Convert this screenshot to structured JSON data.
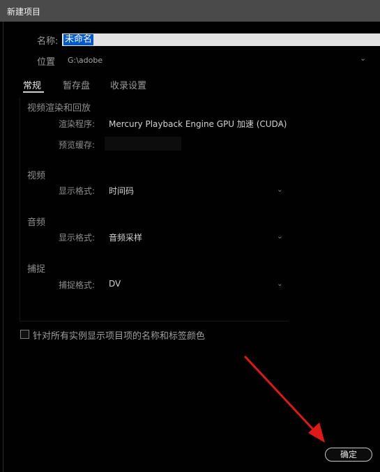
{
  "window": {
    "title": "新建项目"
  },
  "name": {
    "label": "名称:",
    "value": "未命名"
  },
  "location": {
    "label": "位置",
    "value": "G:\\adobe"
  },
  "tabs": [
    {
      "label": "常规",
      "active": true
    },
    {
      "label": "暂存盘",
      "active": false
    },
    {
      "label": "收录设置",
      "active": false
    }
  ],
  "video_render": {
    "section": "视频渲染和回放",
    "renderer_label": "渲染程序:",
    "renderer_value": "Mercury Playback Engine GPU 加速 (CUDA)",
    "cache_label": "预览缓存:"
  },
  "video": {
    "section": "视频",
    "format_label": "显示格式:",
    "format_value": "时间码"
  },
  "audio": {
    "section": "音频",
    "format_label": "显示格式:",
    "format_value": "音频采样"
  },
  "capture": {
    "section": "捕捉",
    "format_label": "捕捉格式:",
    "format_value": "DV"
  },
  "options": {
    "checkbox_label": "针对所有实例显示项目项的名称和标签颜色",
    "checked": false
  },
  "buttons": {
    "ok_label": "确定"
  },
  "colors": {
    "selection": "#0058cf",
    "annotation_arrow": "#e01818"
  }
}
